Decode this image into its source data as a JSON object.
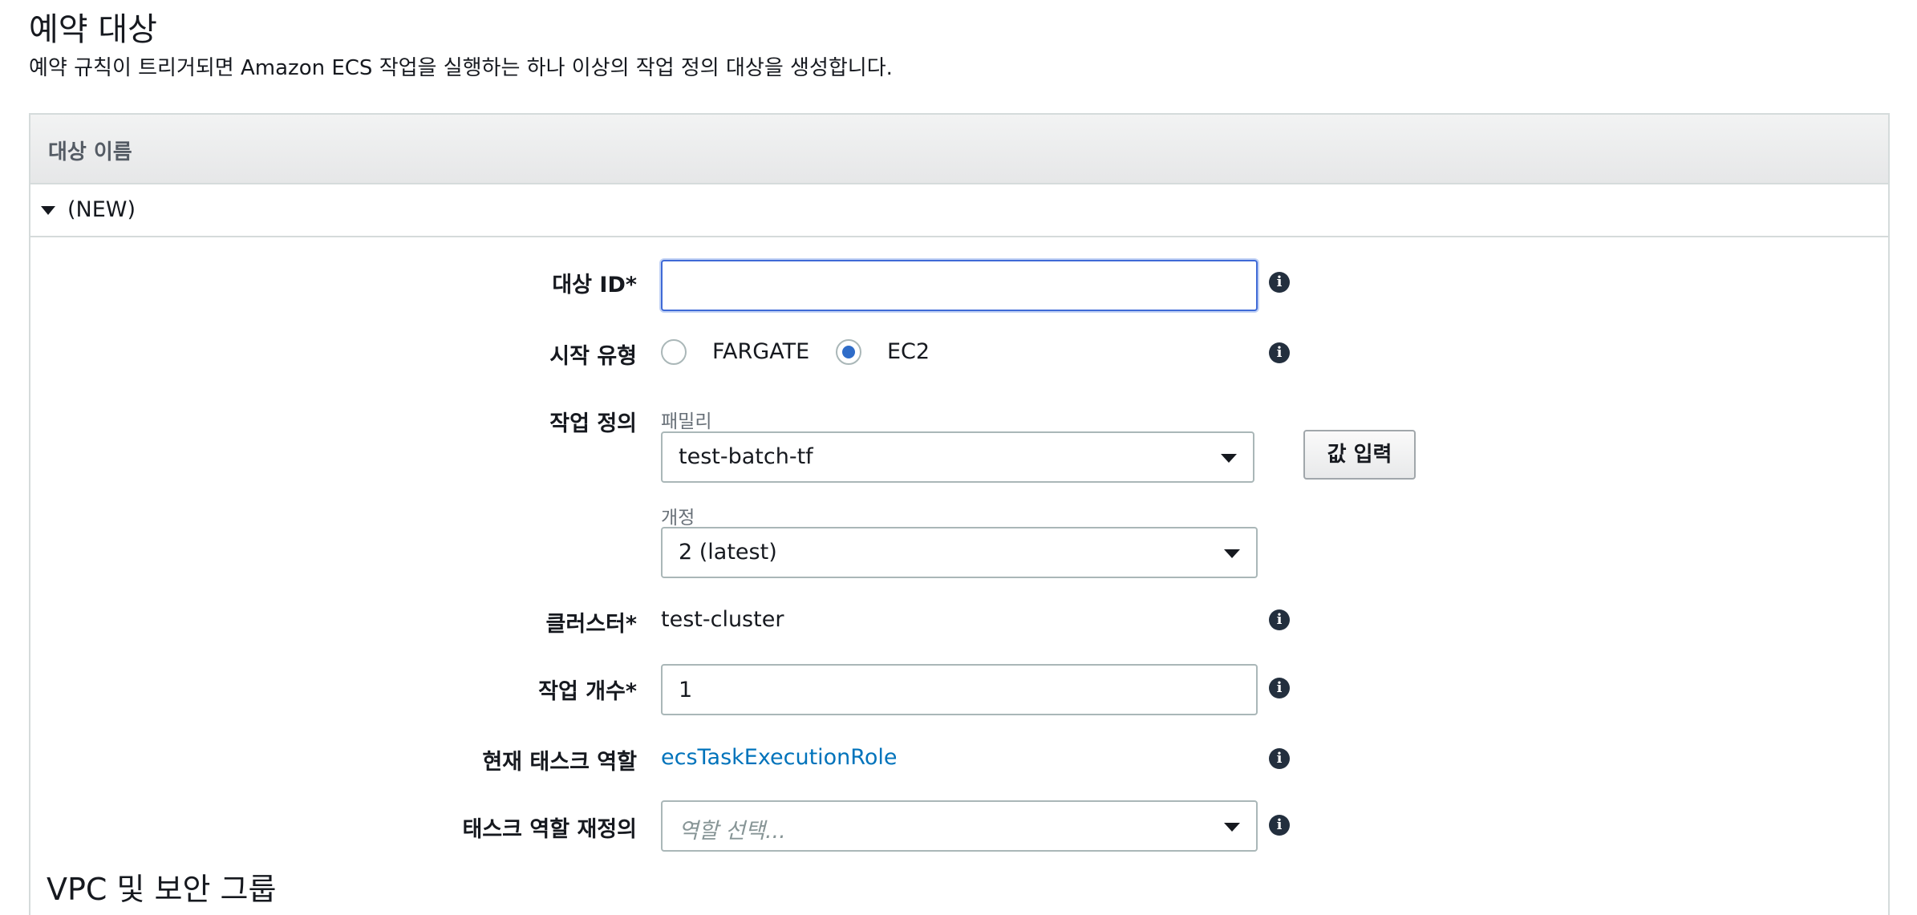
{
  "page": {
    "title": "예약 대상",
    "description": "예약 규칙이 트리거되면 Amazon ECS 작업을 실행하는 하나 이상의 작업 정의 대상을 생성합니다."
  },
  "panel": {
    "header": "대상 이름",
    "target_label": "(NEW)"
  },
  "form": {
    "target_id": {
      "label": "대상 ID*",
      "value": ""
    },
    "launch_type": {
      "label": "시작 유형",
      "options": [
        "FARGATE",
        "EC2"
      ],
      "selected": "EC2"
    },
    "task_definition": {
      "label": "작업 정의",
      "family_label": "패밀리",
      "family_value": "test-batch-tf",
      "revision_label": "개정",
      "revision_value": "2 (latest)",
      "enter_value_button": "값 입력"
    },
    "cluster": {
      "label": "클러스터*",
      "value": "test-cluster"
    },
    "task_count": {
      "label": "작업 개수*",
      "value": "1"
    },
    "current_task_role": {
      "label": "현재 태스크 역할",
      "value": "ecsTaskExecutionRole"
    },
    "task_role_override": {
      "label": "태스크 역할 재정의",
      "placeholder": "역할 선택..."
    }
  },
  "next_section": {
    "title": "VPC 및 보안 그룹"
  },
  "icons": {
    "info": "info-icon",
    "dropdown": "chevron-down-icon",
    "expand": "caret-down-icon"
  },
  "colors": {
    "focus": "#3f6ad6",
    "link": "#0073bb",
    "radio_checked": "#2f6cc8"
  }
}
